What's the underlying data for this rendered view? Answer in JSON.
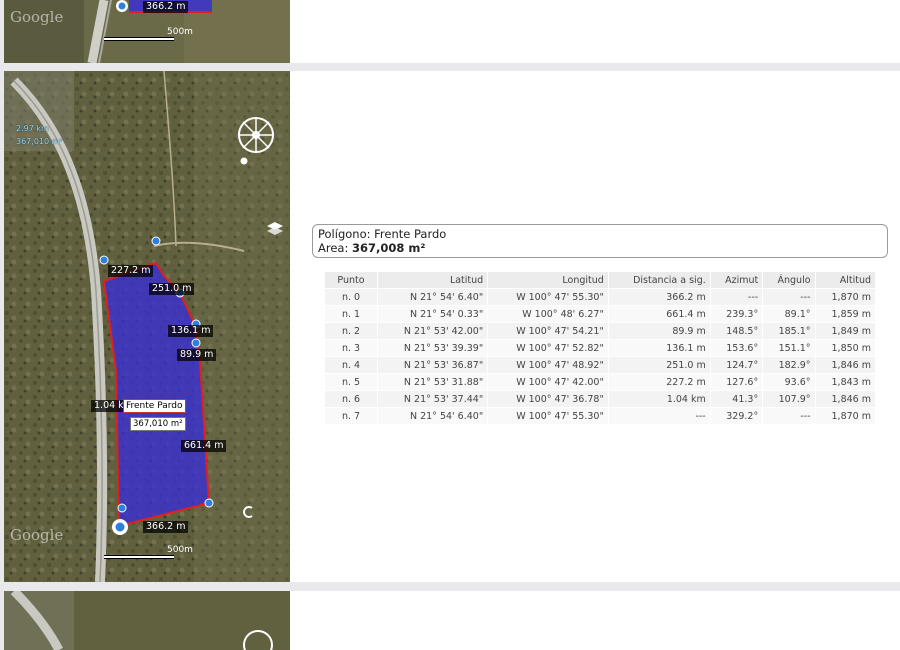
{
  "top_card": {
    "distance_label": "366.2 m",
    "scale_label": "500m",
    "google_label": "Google"
  },
  "map": {
    "measure_distance": "2.97 km",
    "measure_area": "367,010 m²",
    "polygon_name": "Frente Pardo",
    "polygon_area": "367,010 m²",
    "edge_labels": [
      "227.2 m",
      "251.0 m",
      "136.1 m",
      "89.9 m",
      "1.04 km",
      "661.4 m",
      "366.2 m"
    ],
    "scale_label": "500m",
    "google_label": "Google",
    "colors": {
      "polygon_fill": "#3a2fd0",
      "polygon_edge": "#e02020",
      "vertex": "#2f7fe0"
    },
    "icons": [
      "compass-rose-icon",
      "layers-icon",
      "location-icon"
    ]
  },
  "info": {
    "polygon_prefix": "Polígono:",
    "polygon_name": "Frente Pardo",
    "area_prefix": "Area:",
    "area_value": "367,008 m²"
  },
  "table": {
    "headers": [
      "Punto",
      "Latitud",
      "Longitud",
      "Distancia a sig.",
      "Azimut",
      "Ángulo",
      "Altitud"
    ],
    "rows": [
      [
        "n. 0",
        "N 21° 54' 6.40\"",
        "W 100° 47' 55.30\"",
        "366.2 m",
        "---",
        "---",
        "1,870 m"
      ],
      [
        "n. 1",
        "N 21° 54' 0.33\"",
        "W 100° 48' 6.27\"",
        "661.4 m",
        "239.3°",
        "89.1°",
        "1,859 m"
      ],
      [
        "n. 2",
        "N 21° 53' 42.00\"",
        "W 100° 47' 54.21\"",
        "89.9 m",
        "148.5°",
        "185.1°",
        "1,849 m"
      ],
      [
        "n. 3",
        "N 21° 53' 39.39\"",
        "W 100° 47' 52.82\"",
        "136.1 m",
        "153.6°",
        "151.1°",
        "1,850 m"
      ],
      [
        "n. 4",
        "N 21° 53' 36.87\"",
        "W 100° 47' 48.92\"",
        "251.0 m",
        "124.7°",
        "182.9°",
        "1,846 m"
      ],
      [
        "n. 5",
        "N 21° 53' 31.88\"",
        "W 100° 47' 42.00\"",
        "227.2 m",
        "127.6°",
        "93.6°",
        "1,843 m"
      ],
      [
        "n. 6",
        "N 21° 53' 37.44\"",
        "W 100° 47' 36.78\"",
        "1.04 km",
        "41.3°",
        "107.9°",
        "1,846 m"
      ],
      [
        "n. 7",
        "N 21° 54' 6.40\"",
        "W 100° 47' 55.30\"",
        "---",
        "329.2°",
        "---",
        "1,870 m"
      ]
    ]
  }
}
